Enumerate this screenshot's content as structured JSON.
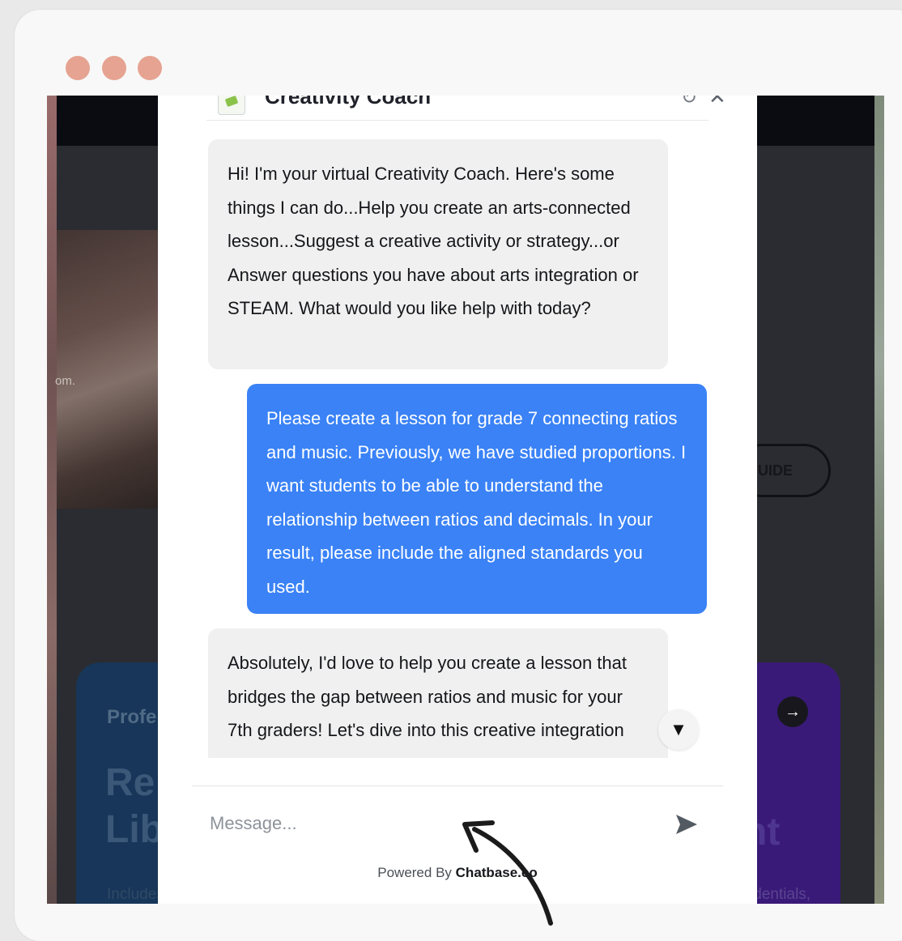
{
  "chat": {
    "bot_name": "Creativity Coach",
    "messages": [
      {
        "role": "bot",
        "text": "Hi! I'm your virtual Creativity Coach. Here's some things I can do...Help you create an arts-connected lesson...Suggest a creative activity or strategy...or Answer questions you have about arts integration or STEAM. What would you like help with today?"
      },
      {
        "role": "user",
        "text": "Please create a lesson for grade 7 connecting ratios and music. Previously, we have studied proportions. I want students to be able to understand the relationship between ratios and decimals. In your result, please include the aligned standards you used."
      },
      {
        "role": "bot",
        "text": "Absolutely, I'd love to help you create a lesson that bridges the gap between ratios and music for your 7th graders! Let's dive into this creative integration"
      }
    ],
    "input_placeholder": "Message...",
    "powered_by_prefix": "Powered By",
    "powered_by_brand": "Chatbase.co",
    "icons": {
      "scroll_down": "triangle-down-icon",
      "send": "send-icon",
      "close": "close-icon",
      "refresh": "refresh-icon"
    }
  },
  "background_page": {
    "photo_caption": "om.",
    "guide_button_label": "UIDE",
    "card_left": {
      "kicker": "Profe",
      "title": "Re\nLib",
      "description": "Includes toolkits, planners, posters,"
    },
    "card_right": {
      "title": "nt",
      "description": "Includes courses, micro-credentials,"
    }
  },
  "colors": {
    "user_bubble": "#3a82f6",
    "bot_bubble": "#f0f0f0",
    "window_dots": "#e6a391",
    "annotation_arrow": "#1b1b1b"
  }
}
